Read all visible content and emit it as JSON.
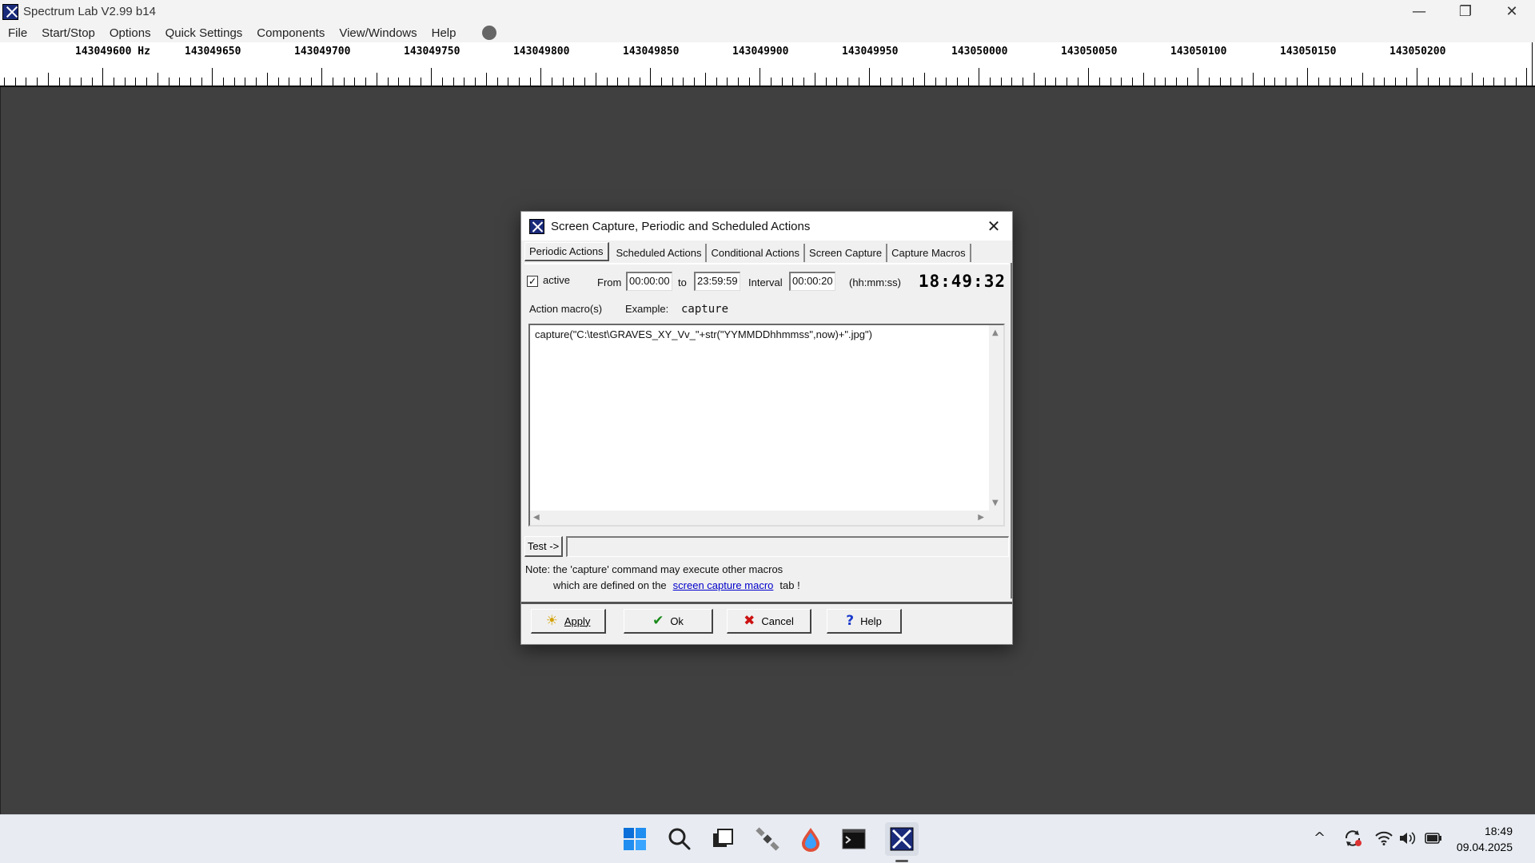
{
  "window": {
    "title": "Spectrum Lab V2.99 b14",
    "minimize": "—",
    "restore": "❐",
    "close": "✕"
  },
  "menu": [
    "File",
    "Start/Stop",
    "Options",
    "Quick Settings",
    "Components",
    "View/Windows",
    "Help"
  ],
  "ruler": {
    "labels": [
      "143049600 Hz",
      "143049650",
      "143049700",
      "143049750",
      "143049800",
      "143049850",
      "143049900",
      "143049950",
      "143050000",
      "143050050",
      "143050100",
      "143050150",
      "143050200"
    ]
  },
  "dialog": {
    "title": "Screen Capture, Periodic and Scheduled Actions",
    "close": "✕",
    "tabs": [
      "Periodic Actions",
      "Scheduled Actions",
      "Conditional Actions",
      "Screen Capture",
      "Capture Macros"
    ],
    "selected_tab": "Periodic Actions",
    "active_checked": true,
    "check_mark": "✓",
    "active_label": "active",
    "from_label": "From",
    "from_value": "00:00:00",
    "to_label": "to",
    "to_value": "23:59:59",
    "interval_label": "Interval",
    "interval_value": "00:00:20",
    "format_hint": "(hh:mm:ss)",
    "clock": "18:49:32",
    "macro_label": "Action macro(s)",
    "example_label": "Example:",
    "example_value": "capture",
    "macro_text": "capture(\"C:\\test\\GRAVES_XY_Vv_\"+str(\"YYMMDDhhmmss\",now)+\".jpg\")",
    "scroll_up": "▲",
    "scroll_down": "▼",
    "scroll_left": "◀",
    "scroll_right": "▶",
    "test_label": "Test ->",
    "test_value": "",
    "note_line1": "Note: the 'capture' command  may  execute other macros",
    "note_line2_prefix": "which are defined on the",
    "note_link": "screen capture macro",
    "note_line2_suffix": "tab !",
    "buttons": {
      "apply": "Apply",
      "ok": "Ok",
      "cancel": "Cancel",
      "help": "Help"
    },
    "button_icons": {
      "apply": "☀",
      "ok": "✔",
      "cancel": "✖",
      "help": "?"
    },
    "colors": {
      "ok": "#1a8a1a",
      "cancel": "#cc1111",
      "help": "#1a3acc",
      "apply": "#d4a000"
    }
  },
  "taskbar": {
    "tray_chevron": "^",
    "time": "18:49",
    "date": "09.04.2025"
  }
}
